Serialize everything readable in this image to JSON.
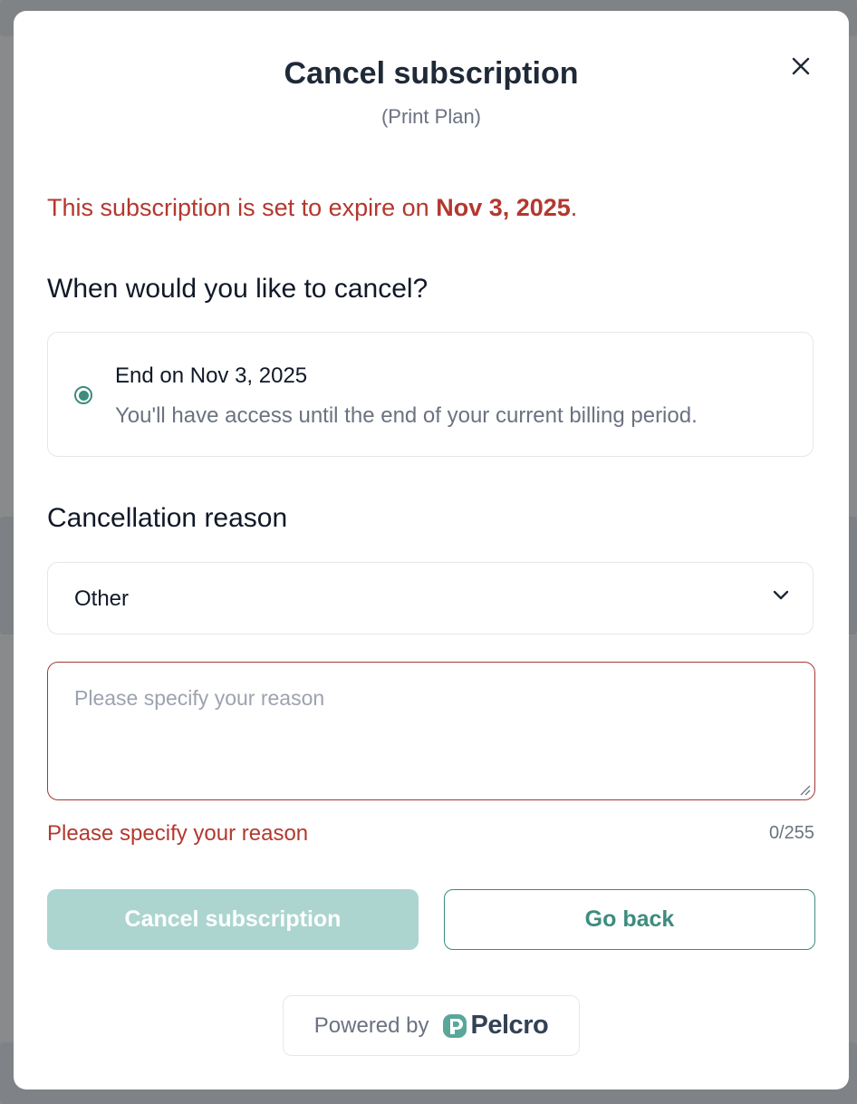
{
  "modal": {
    "title": "Cancel subscription",
    "subtitle": "(Print Plan)",
    "expire_prefix": "This subscription is set to expire on ",
    "expire_date": "Nov 3, 2025",
    "expire_suffix": ".",
    "when_heading": "When would you like to cancel?",
    "option": {
      "title": "End on Nov 3, 2025",
      "description": "You'll have access until the end of your current billing period.",
      "selected": true
    },
    "reason_heading": "Cancellation reason",
    "reason_select": {
      "value": "Other"
    },
    "reason_input": {
      "value": "",
      "placeholder": "Please specify your reason"
    },
    "error_text": "Please specify your reason",
    "char_counter": "0/255",
    "cancel_button": "Cancel subscription",
    "back_button": "Go back",
    "powered_by": "Powered by",
    "brand": "Pelcro"
  },
  "icons": {
    "close": "close-icon",
    "chevron": "chevron-down-icon",
    "logo": "pelcro-logo-icon"
  },
  "colors": {
    "accent": "#3d8c7f",
    "error": "#b3382f",
    "disabled_button": "#acd5cf"
  }
}
